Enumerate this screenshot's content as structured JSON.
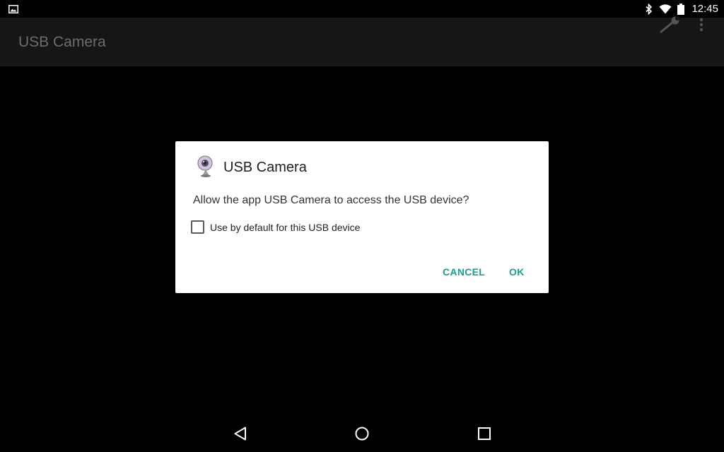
{
  "status_bar": {
    "time": "12:45",
    "icons": [
      "image-notification-icon",
      "bluetooth-icon",
      "wifi-icon",
      "battery-icon"
    ]
  },
  "action_bar": {
    "title": "USB Camera",
    "actions": [
      "wrench-icon",
      "overflow-menu-icon"
    ]
  },
  "dialog": {
    "icon": "webcam-icon",
    "title": "USB Camera",
    "message": "Allow the app USB Camera to access the USB device?",
    "checkbox_label": "Use by default for this USB device",
    "checkbox_checked": false,
    "cancel_label": "CANCEL",
    "ok_label": "OK",
    "accent_color": "#1e9c8f"
  },
  "nav_bar": {
    "buttons": [
      "back-icon",
      "home-icon",
      "recents-icon"
    ]
  }
}
